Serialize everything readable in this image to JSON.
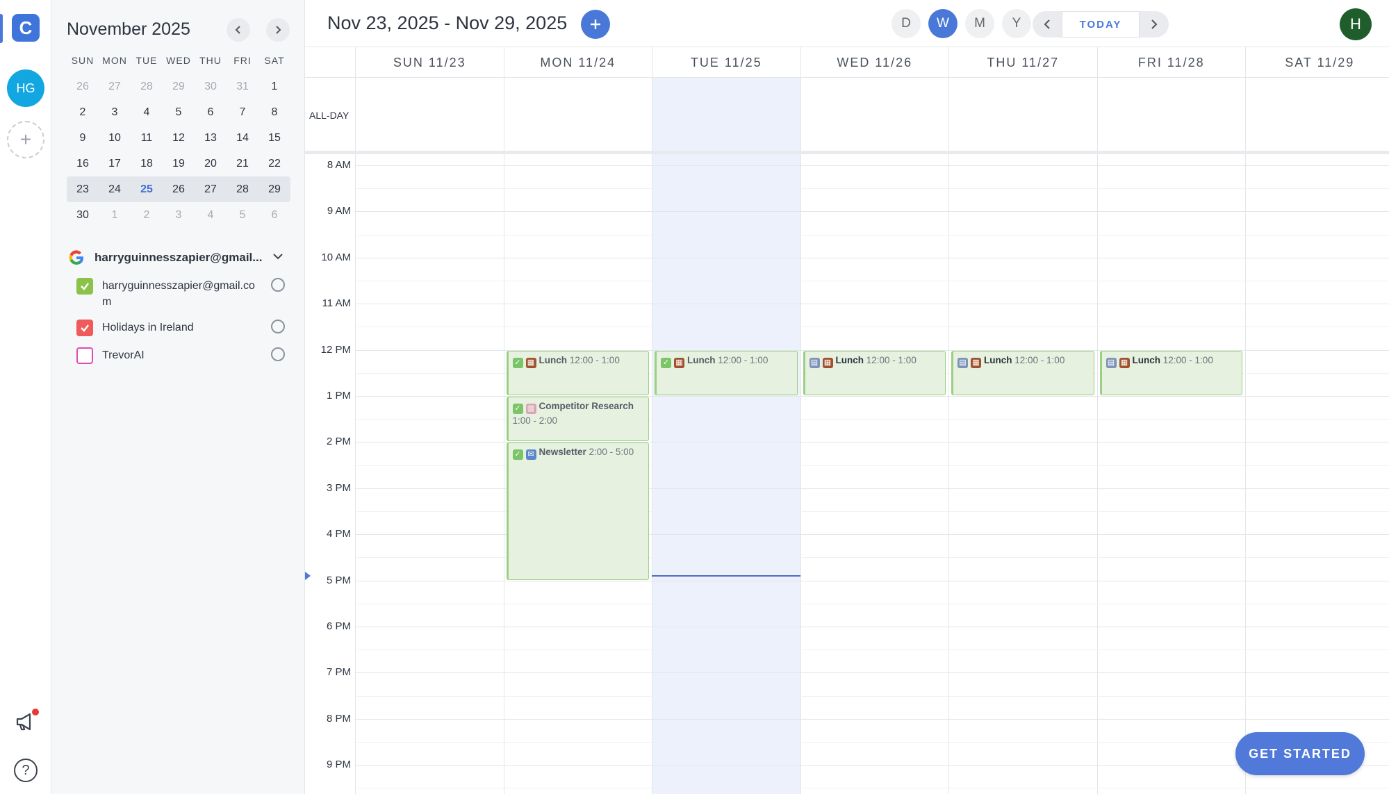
{
  "rail": {
    "logo_letter": "C",
    "avatar_initials": "HG",
    "add_symbol": "+",
    "help_symbol": "?",
    "icons": [
      "logo-icon",
      "plus-icon",
      "megaphone-icon",
      "help-icon"
    ]
  },
  "mini_calendar": {
    "title": "November 2025",
    "weekdays": [
      "SUN",
      "MON",
      "TUE",
      "WED",
      "THU",
      "FRI",
      "SAT"
    ],
    "weeks": [
      [
        "26",
        "27",
        "28",
        "29",
        "30",
        "31",
        "1"
      ],
      [
        "2",
        "3",
        "4",
        "5",
        "6",
        "7",
        "8"
      ],
      [
        "9",
        "10",
        "11",
        "12",
        "13",
        "14",
        "15"
      ],
      [
        "16",
        "17",
        "18",
        "19",
        "20",
        "21",
        "22"
      ],
      [
        "23",
        "24",
        "25",
        "26",
        "27",
        "28",
        "29"
      ],
      [
        "30",
        "1",
        "2",
        "3",
        "4",
        "5",
        "6"
      ]
    ],
    "today": "25"
  },
  "account": {
    "name": "harryguinnesszapier@gmail...",
    "calendars": [
      {
        "label": "harryguinnesszapier@gmail.com",
        "checked": true,
        "color": "#8bc34a"
      },
      {
        "label": "Holidays in Ireland",
        "checked": true,
        "color": "#ef5a5a"
      },
      {
        "label": "TrevorAI",
        "checked": false,
        "color": "#e04bb5"
      }
    ]
  },
  "header": {
    "range_title": "Nov 23, 2025 - Nov 29, 2025",
    "today_label": "TODAY",
    "views": [
      "D",
      "W",
      "M",
      "Y"
    ],
    "active_view": "W",
    "user_initial": "H"
  },
  "days": [
    "SUN 11/23",
    "MON 11/24",
    "TUE 11/25",
    "WED 11/26",
    "THU 11/27",
    "FRI 11/28",
    "SAT 11/29"
  ],
  "allday_label": "ALL-DAY",
  "hours": [
    "8 AM",
    "9 AM",
    "10 AM",
    "11 AM",
    "12 PM",
    "1 PM",
    "2 PM",
    "3 PM",
    "4 PM",
    "5 PM",
    "6 PM",
    "7 PM",
    "8 PM",
    "9 PM"
  ],
  "events": [
    {
      "day": 1,
      "start": 12,
      "end": 13,
      "icons": [
        "check",
        "food"
      ],
      "title": "Lunch",
      "time": "12:00 - 1:00",
      "strong": false
    },
    {
      "day": 1,
      "start": 13,
      "end": 14,
      "icons": [
        "check",
        "chart"
      ],
      "title": "Competitor Research",
      "time": "1:00 - 2:00",
      "strong": false
    },
    {
      "day": 1,
      "start": 14,
      "end": 17,
      "icons": [
        "check",
        "mail"
      ],
      "title": "Newsletter",
      "time": "2:00 - 5:00",
      "strong": false
    },
    {
      "day": 2,
      "start": 12,
      "end": 13,
      "icons": [
        "check",
        "food"
      ],
      "title": "Lunch",
      "time": "12:00 - 1:00",
      "strong": false
    },
    {
      "day": 3,
      "start": 12,
      "end": 13,
      "icons": [
        "cal",
        "food"
      ],
      "title": "Lunch",
      "time": "12:00 - 1:00",
      "strong": true
    },
    {
      "day": 4,
      "start": 12,
      "end": 13,
      "icons": [
        "cal",
        "food"
      ],
      "title": "Lunch",
      "time": "12:00 - 1:00",
      "strong": true
    },
    {
      "day": 5,
      "start": 12,
      "end": 13,
      "icons": [
        "cal",
        "food"
      ],
      "title": "Lunch",
      "time": "12:00 - 1:00",
      "strong": true
    }
  ],
  "today_index": 2,
  "now_hour": 16.88,
  "cta": "GET STARTED"
}
